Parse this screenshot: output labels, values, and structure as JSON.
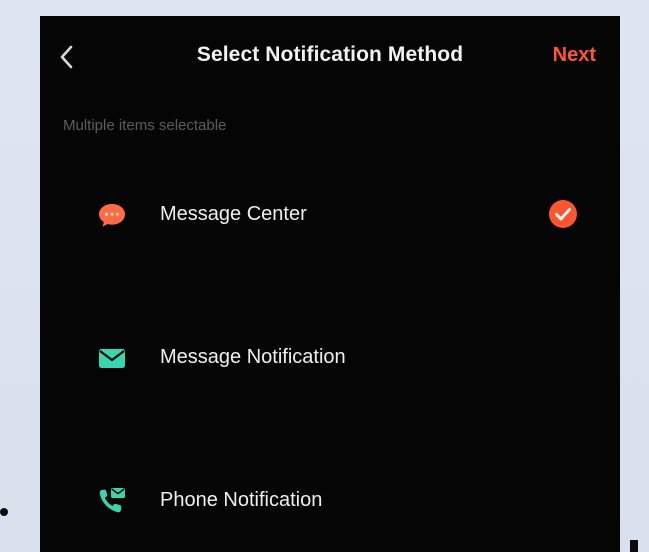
{
  "header": {
    "title": "Select Notification Method",
    "next_label": "Next",
    "back_icon": "chevron-left-icon"
  },
  "hint": "Multiple items selectable",
  "options": [
    {
      "label": "Message Center",
      "icon": "chat-bubble-icon",
      "icon_color": "#ff6b45",
      "selected": true
    },
    {
      "label": "Message Notification",
      "icon": "envelope-icon",
      "icon_color": "#38d6b0",
      "selected": false
    },
    {
      "label": "Phone Notification",
      "icon": "phone-message-icon",
      "icon_color": "#38d6b0",
      "selected": false
    }
  ],
  "colors": {
    "accent": "#ff5631",
    "background": "#050505",
    "text": "#efefef",
    "hint": "#5d5d5d"
  }
}
